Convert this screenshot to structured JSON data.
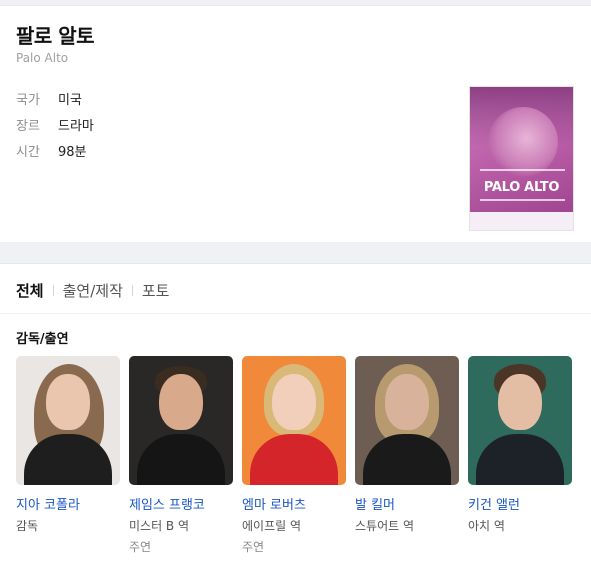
{
  "movie": {
    "title": "팔로 알토",
    "original_title": "Palo Alto",
    "info": [
      {
        "label": "국가",
        "value": "미국"
      },
      {
        "label": "장르",
        "value": "드라마"
      },
      {
        "label": "시간",
        "value": "98분"
      }
    ],
    "poster_title": "PALO ALTO"
  },
  "tabs": [
    "전체",
    "출연/제작",
    "포토"
  ],
  "section_title": "감독/출연",
  "cast": [
    {
      "name": "지아 코폴라",
      "role": "감독",
      "credit": ""
    },
    {
      "name": "제임스 프랭코",
      "role": "미스터 B 역",
      "credit": "주연"
    },
    {
      "name": "엠마 로버츠",
      "role": "에이프릴 역",
      "credit": "주연"
    },
    {
      "name": "발 킬머",
      "role": "스튜어트 역",
      "credit": ""
    },
    {
      "name": "키건 앨런",
      "role": "아치 역",
      "credit": ""
    }
  ],
  "colors": {
    "link": "#1a56c4",
    "poster": "#c46bb4"
  }
}
